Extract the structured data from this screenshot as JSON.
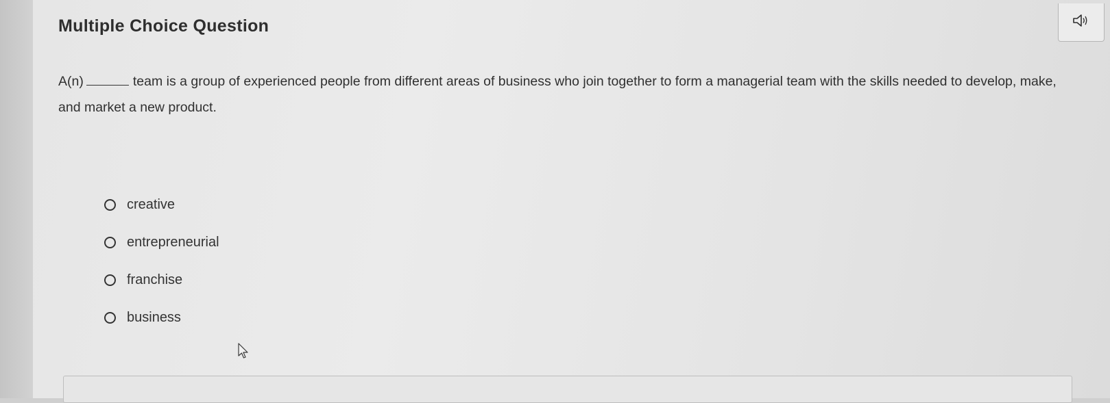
{
  "header": {
    "title": "Multiple Choice Question",
    "audio_icon": "speaker-icon"
  },
  "question": {
    "prefix": "A(n)",
    "text": "team is a group of experienced people from different areas of business who join together to form a managerial team with the skills needed to develop, make, and market a new product."
  },
  "options": [
    {
      "label": "creative"
    },
    {
      "label": "entrepreneurial"
    },
    {
      "label": "franchise"
    },
    {
      "label": "business"
    }
  ],
  "colors": {
    "background": "#e8e8e8",
    "text": "#303030"
  }
}
